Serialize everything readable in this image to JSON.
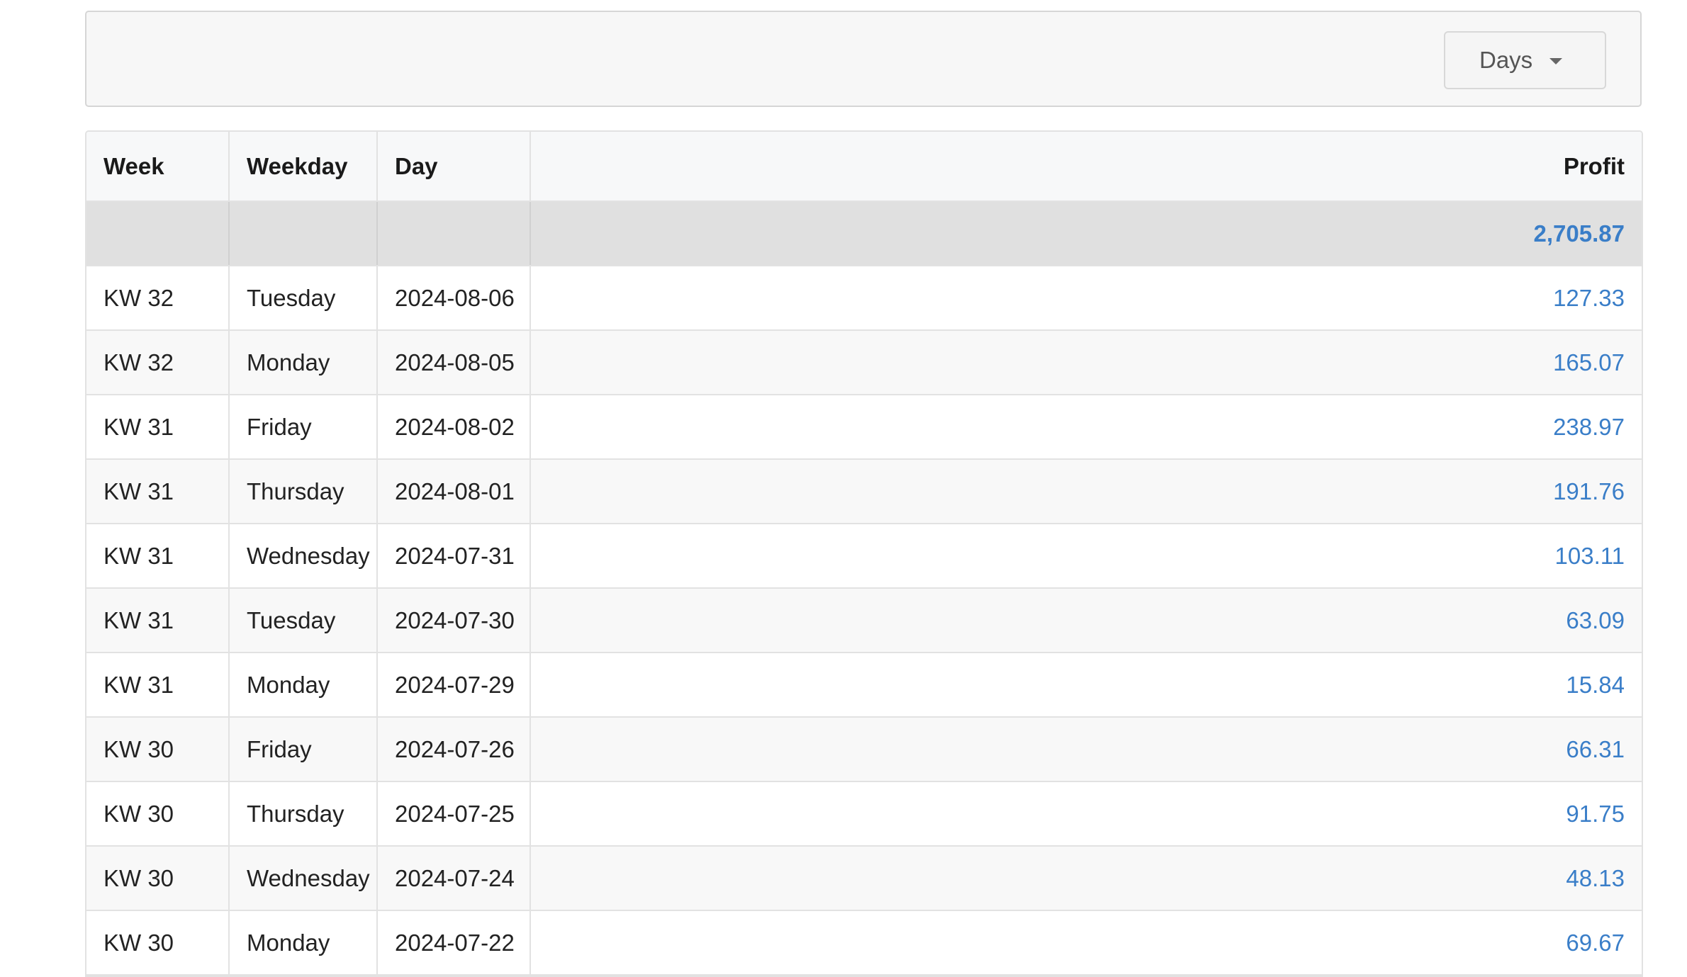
{
  "toolbar": {
    "grouping_select": {
      "value": "Days",
      "icon": "chevron-down-icon"
    }
  },
  "table": {
    "columns": [
      "Week",
      "Weekday",
      "Day",
      "Profit"
    ],
    "total": {
      "profit": "2,705.87"
    },
    "rows": [
      {
        "week": "KW 32",
        "weekday": "Tuesday",
        "day": "2024-08-06",
        "profit": "127.33"
      },
      {
        "week": "KW 32",
        "weekday": "Monday",
        "day": "2024-08-05",
        "profit": "165.07"
      },
      {
        "week": "KW 31",
        "weekday": "Friday",
        "day": "2024-08-02",
        "profit": "238.97"
      },
      {
        "week": "KW 31",
        "weekday": "Thursday",
        "day": "2024-08-01",
        "profit": "191.76"
      },
      {
        "week": "KW 31",
        "weekday": "Wednesday",
        "day": "2024-07-31",
        "profit": "103.11"
      },
      {
        "week": "KW 31",
        "weekday": "Tuesday",
        "day": "2024-07-30",
        "profit": "63.09"
      },
      {
        "week": "KW 31",
        "weekday": "Monday",
        "day": "2024-07-29",
        "profit": "15.84"
      },
      {
        "week": "KW 30",
        "weekday": "Friday",
        "day": "2024-07-26",
        "profit": "66.31"
      },
      {
        "week": "KW 30",
        "weekday": "Thursday",
        "day": "2024-07-25",
        "profit": "91.75"
      },
      {
        "week": "KW 30",
        "weekday": "Wednesday",
        "day": "2024-07-24",
        "profit": "48.13"
      },
      {
        "week": "KW 30",
        "weekday": "Monday",
        "day": "2024-07-22",
        "profit": "69.67"
      }
    ]
  },
  "colors": {
    "profit_text": "#3a7ec8",
    "total_row_bg": "#e0e0e0",
    "toolbar_bg": "#f7f7f7"
  }
}
